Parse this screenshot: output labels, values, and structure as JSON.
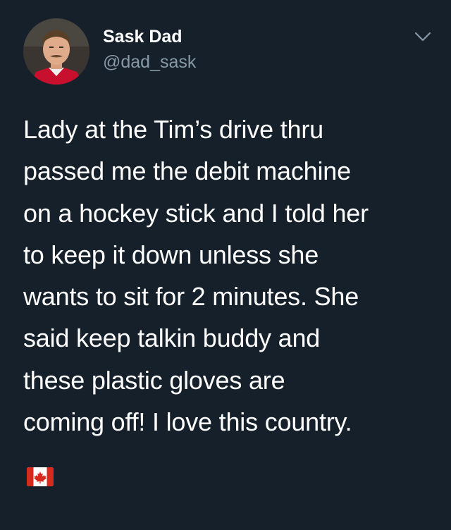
{
  "tweet": {
    "display_name": "Sask Dad",
    "handle": "@dad_sask",
    "text": "Lady at the Tim’s drive thru\npassed me the debit machine\non a hockey stick and I told her\nto keep it down unless she\nwants to sit for 2 minutes. She\nsaid keep talkin buddy and\nthese plastic gloves are\ncoming off! I love this country.",
    "emoji": "canada-flag-icon"
  },
  "icons": {
    "menu": "chevron-down-icon",
    "avatar": "profile-photo"
  },
  "colors": {
    "background": "#15202b",
    "primary_text": "#ffffff",
    "secondary_text": "#8899a6",
    "flag_red": "#d52b1e"
  }
}
